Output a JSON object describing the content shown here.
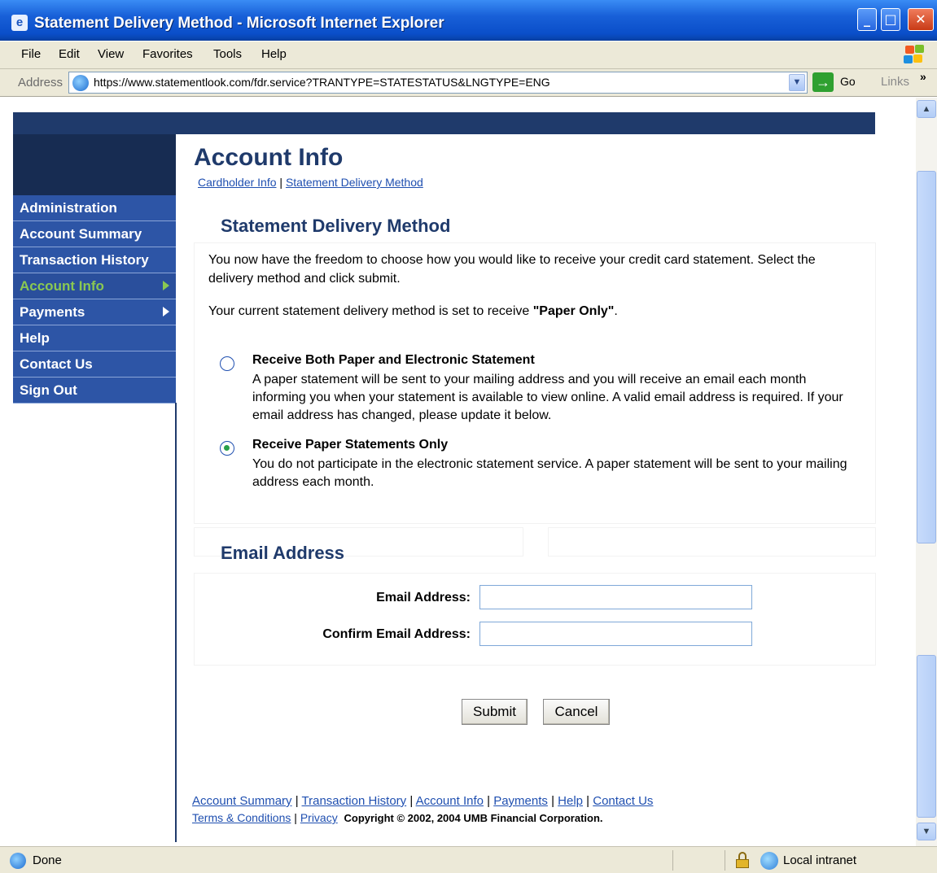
{
  "window": {
    "title": "Statement Delivery Method - Microsoft Internet Explorer"
  },
  "menu": [
    "File",
    "Edit",
    "View",
    "Favorites",
    "Tools",
    "Help"
  ],
  "address_bar": {
    "label": "Address",
    "url": "https://www.statementlook.com/fdr.service?TRANTYPE=STATESTATUS&LNGTYPE=ENG",
    "go_label": "Go",
    "links_label": "Links"
  },
  "sidebar": {
    "items": [
      {
        "label": "Administration"
      },
      {
        "label": "Account Summary"
      },
      {
        "label": "Transaction History"
      },
      {
        "label": "Account Info"
      },
      {
        "label": "Payments"
      },
      {
        "label": "Help"
      },
      {
        "label": "Contact Us"
      },
      {
        "label": "Sign Out"
      }
    ]
  },
  "main": {
    "title": "Account Info",
    "breadcrumb": {
      "link1": "Cardholder Info",
      "sep": " | ",
      "link2": "Statement Delivery Method"
    },
    "delivery_section": {
      "title": "Statement Delivery Method",
      "intro": "You now have the freedom to choose how you would like to receive your credit card statement. Select the delivery method and click submit.",
      "current_prefix": "Your current statement delivery method is set to receive ",
      "current_value": "\"Paper Only\"",
      "current_suffix": ".",
      "options": [
        {
          "title": "Receive Both Paper and Electronic Statement",
          "description": "A paper statement will be sent to your mailing address and you will receive an email each month informing you when your statement is available to view online. A valid email address is required. If your email address has changed, please update it below.",
          "selected": false
        },
        {
          "title": "Receive Paper Statements Only",
          "description": "You do not participate in the electronic statement service. A paper statement will be sent to your mailing address each month.",
          "selected": true
        }
      ]
    },
    "email_section": {
      "title": "Email Address",
      "email_label": "Email Address:",
      "confirm_label": "Confirm Email Address:",
      "email_value": "",
      "confirm_value": ""
    },
    "buttons": {
      "submit": "Submit",
      "cancel": "Cancel"
    },
    "footer": {
      "links_row1": [
        "Account Summary",
        "Transaction History",
        "Account Info",
        "Payments",
        "Help",
        "Contact Us"
      ],
      "links_row2": [
        "Terms & Conditions",
        "Privacy"
      ],
      "copyright": "Copyright © 2002, 2004 UMB Financial Corporation."
    }
  },
  "status_bar": {
    "status": "Done",
    "zone": "Local intranet"
  },
  "colors": {
    "title_bar": "#0a4ec9",
    "nav_blue": "#2d55a6",
    "nav_active_text": "#8ac852",
    "heading": "#1f3a6b",
    "link": "#1f4fb0"
  }
}
